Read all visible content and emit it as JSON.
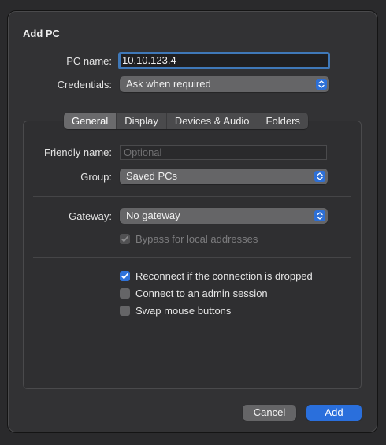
{
  "dialog": {
    "title": "Add PC"
  },
  "pc_name": {
    "label": "PC name:",
    "value": "10.10.123.4"
  },
  "credentials": {
    "label": "Credentials:",
    "value": "Ask when required"
  },
  "tabs": [
    {
      "label": "General",
      "selected": true
    },
    {
      "label": "Display"
    },
    {
      "label": "Devices & Audio"
    },
    {
      "label": "Folders"
    }
  ],
  "general": {
    "friendly_name": {
      "label": "Friendly name:",
      "placeholder": "Optional"
    },
    "group": {
      "label": "Group:",
      "value": "Saved PCs"
    },
    "gateway": {
      "label": "Gateway:",
      "value": "No gateway"
    },
    "bypass": {
      "label": "Bypass for local addresses",
      "checked": true,
      "disabled": true
    },
    "reconnect": {
      "label": "Reconnect if the connection is dropped",
      "checked": true
    },
    "admin_session": {
      "label": "Connect to an admin session",
      "checked": false
    },
    "swap_mouse": {
      "label": "Swap mouse buttons",
      "checked": false
    }
  },
  "buttons": {
    "cancel": "Cancel",
    "add": "Add"
  },
  "colors": {
    "accent": "#2a6fdc",
    "background": "#323234"
  }
}
